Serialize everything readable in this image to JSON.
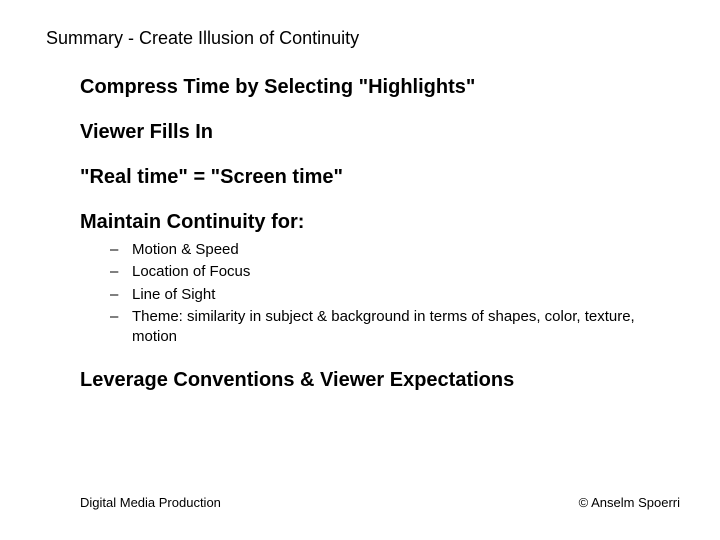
{
  "title": "Summary - Create Illusion of Continuity",
  "points": {
    "p1": "Compress Time by Selecting \"Highlights\"",
    "p2": "Viewer Fills In",
    "p3": "\"Real time\" = \"Screen time\"",
    "p4": "Maintain Continuity for:",
    "p5": "Leverage Conventions & Viewer Expectations"
  },
  "continuity_items": {
    "i1": "Motion & Speed",
    "i2": "Location of Focus",
    "i3": "Line of Sight",
    "i4": "Theme: similarity in subject & background in terms of shapes, color, texture, motion"
  },
  "footer": {
    "left": "Digital Media Production",
    "right": "© Anselm Spoerri"
  }
}
